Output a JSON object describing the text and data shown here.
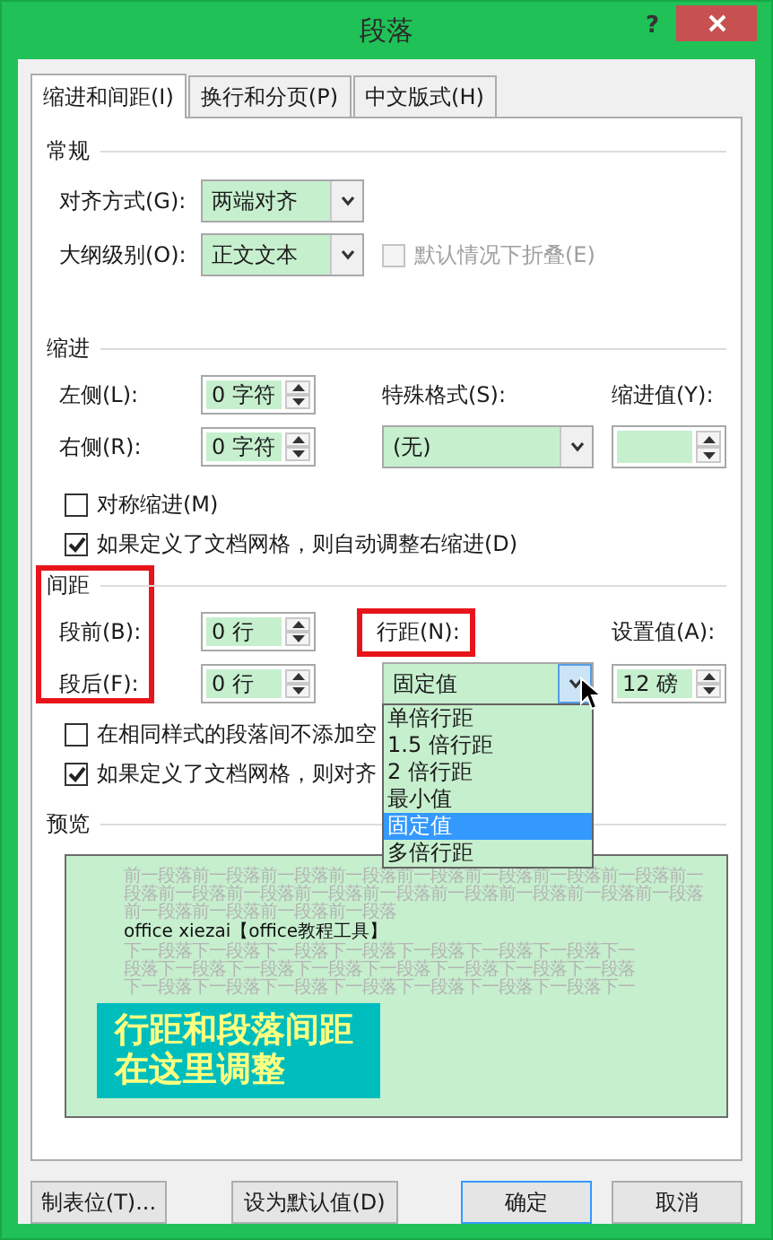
{
  "window": {
    "title": "段落",
    "help": "?"
  },
  "tabs": [
    {
      "label": "缩进和间距(I)",
      "selected": true
    },
    {
      "label": "换行和分页(P)",
      "selected": false
    },
    {
      "label": "中文版式(H)",
      "selected": false
    }
  ],
  "general": {
    "heading": "常规",
    "alignment": {
      "label": "对齐方式(G):",
      "value": "两端对齐"
    },
    "outline_level": {
      "label": "大纲级别(O):",
      "value": "正文文本"
    },
    "collapse": {
      "label": "默认情况下折叠(E)",
      "checked": false,
      "disabled": true
    }
  },
  "indent": {
    "heading": "缩进",
    "left": {
      "label": "左侧(L):",
      "value": "0 字符"
    },
    "right": {
      "label": "右侧(R):",
      "value": "0 字符"
    },
    "special": {
      "label": "特殊格式(S):",
      "value": "(无)"
    },
    "by": {
      "label": "缩进值(Y):"
    },
    "checkboxes": [
      {
        "label": "对称缩进(M)",
        "checked": false
      },
      {
        "label": "如果定义了文档网格，则自动调整右缩进(D)",
        "checked": true
      }
    ]
  },
  "spacing": {
    "heading": "间距",
    "before": {
      "label": "段前(B):",
      "value": "0 行"
    },
    "after": {
      "label": "段后(F):",
      "value": "0 行"
    },
    "line_spacing": {
      "label": "行距(N):",
      "value": "固定值",
      "expanded": true,
      "options": [
        {
          "label": "单倍行距",
          "selected": false
        },
        {
          "label": "1.5 倍行距",
          "selected": false
        },
        {
          "label": "2 倍行距",
          "selected": false
        },
        {
          "label": "最小值",
          "selected": false
        },
        {
          "label": "固定值",
          "selected": true
        },
        {
          "label": "多倍行距",
          "selected": false
        }
      ]
    },
    "at": {
      "label": "设置值(A):",
      "value": "12 磅"
    },
    "checkboxes": [
      {
        "label": "在相同样式的段落间不添加空",
        "checked": false
      },
      {
        "label": "如果定义了文档网格，则对齐",
        "checked": true
      }
    ]
  },
  "preview": {
    "heading": "预览",
    "lines_before": [
      "前一段落前一段落前一段落前一段落前一段落前一段落前一段落前一段落前一",
      "段落前一段落前一段落前一段落前一段落前一段落前一段落前一段落前一段落",
      "前一段落前一段落前一段落前一段落"
    ],
    "sample": "office xiezai【office教程工具】",
    "lines_after": [
      "下一段落下一段落下一段落下一段落下一段落下一段落下一段落下一",
      "段落下一段落下一段落下一段落下一段落下一段落下一段落下一段落",
      "下一段落下一段落下一段落下一段落下一段落下一段落下一段落下一"
    ]
  },
  "callout": "行距和段落间距在这里调整",
  "buttons": [
    {
      "label": "制表位(T)...",
      "default": false
    },
    {
      "label": "设为默认值(D)",
      "default": false
    },
    {
      "label": "确定",
      "default": true
    },
    {
      "label": "取消",
      "default": false
    }
  ]
}
